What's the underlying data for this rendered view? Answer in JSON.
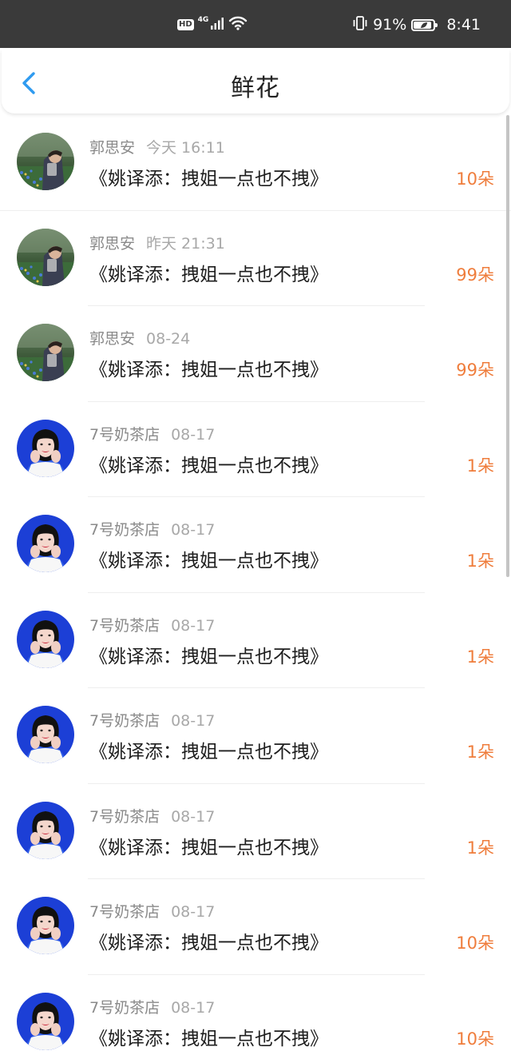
{
  "status_bar": {
    "hd": "HD",
    "network": "4G",
    "battery_text": "91%",
    "battery_level": 0.91,
    "time": "8:41",
    "icons": [
      "hd-icon",
      "signal-icon",
      "wifi-icon",
      "vibrate-icon",
      "battery-icon"
    ]
  },
  "header": {
    "title": "鲜花",
    "back_icon": "chevron-left-icon",
    "accent_color": "#2f9bf0"
  },
  "colors": {
    "count": "#ef7d3c",
    "name": "#8a8a8a",
    "time": "#a8a8a8"
  },
  "list": [
    {
      "name": "郭思安",
      "time": "今天 16:11",
      "message": "《姚译添：拽姐一点也不拽》",
      "count": "10朵",
      "avatar": "landscape-photo"
    },
    {
      "name": "郭思安",
      "time": "昨天 21:31",
      "message": "《姚译添：拽姐一点也不拽》",
      "count": "99朵",
      "avatar": "landscape-photo"
    },
    {
      "name": "郭思安",
      "time": "08-24",
      "message": "《姚译添：拽姐一点也不拽》",
      "count": "99朵",
      "avatar": "landscape-photo"
    },
    {
      "name": "7号奶茶店",
      "time": "08-17",
      "message": "《姚译添：拽姐一点也不拽》",
      "count": "1朵",
      "avatar": "portrait-photo"
    },
    {
      "name": "7号奶茶店",
      "time": "08-17",
      "message": "《姚译添：拽姐一点也不拽》",
      "count": "1朵",
      "avatar": "portrait-photo"
    },
    {
      "name": "7号奶茶店",
      "time": "08-17",
      "message": "《姚译添：拽姐一点也不拽》",
      "count": "1朵",
      "avatar": "portrait-photo"
    },
    {
      "name": "7号奶茶店",
      "time": "08-17",
      "message": "《姚译添：拽姐一点也不拽》",
      "count": "1朵",
      "avatar": "portrait-photo"
    },
    {
      "name": "7号奶茶店",
      "time": "08-17",
      "message": "《姚译添：拽姐一点也不拽》",
      "count": "1朵",
      "avatar": "portrait-photo"
    },
    {
      "name": "7号奶茶店",
      "time": "08-17",
      "message": "《姚译添：拽姐一点也不拽》",
      "count": "10朵",
      "avatar": "portrait-photo"
    },
    {
      "name": "7号奶茶店",
      "time": "08-17",
      "message": "《姚译添：拽姐一点也不拽》",
      "count": "10朵",
      "avatar": "portrait-photo"
    }
  ]
}
